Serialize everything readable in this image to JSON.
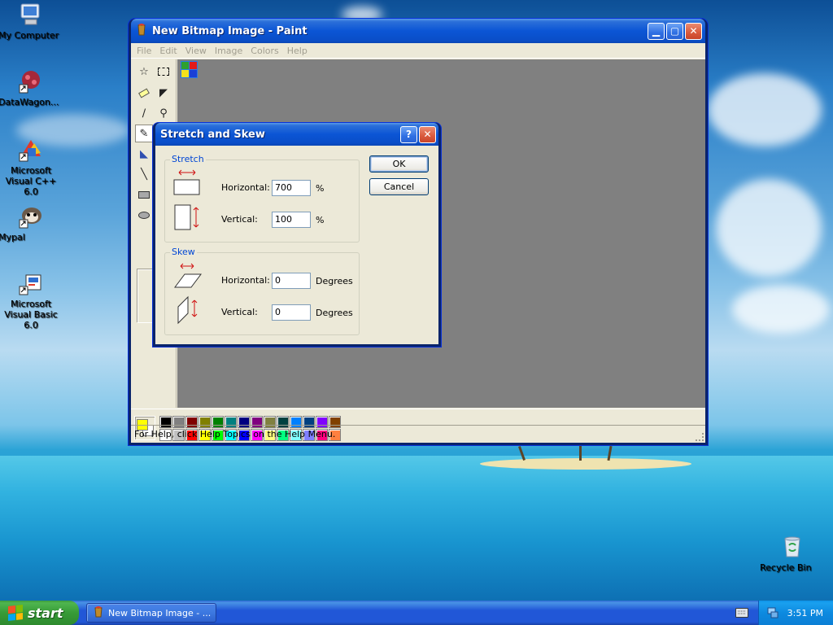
{
  "desktop": {
    "icons": [
      {
        "label": "My Computer"
      },
      {
        "label": "DataWagon..."
      },
      {
        "label": "Microsoft Visual C++ 6.0"
      },
      {
        "label": "Mypal"
      },
      {
        "label": "Microsoft Visual Basic 6.0"
      },
      {
        "label": "Recycle Bin"
      }
    ]
  },
  "paint": {
    "title": "New Bitmap Image - Paint",
    "menu": [
      "File",
      "Edit",
      "View",
      "Image",
      "Colors",
      "Help"
    ],
    "status_text": "For Help, click Help Topics on the Help Menu.",
    "palette_top": [
      "#000000",
      "#808080",
      "#800000",
      "#808000",
      "#008000",
      "#008080",
      "#000080",
      "#800080",
      "#808040",
      "#004040",
      "#0080ff",
      "#004080",
      "#8000ff",
      "#804000"
    ],
    "palette_bottom": [
      "#ffffff",
      "#c0c0c0",
      "#ff0000",
      "#ffff00",
      "#00ff00",
      "#00ffff",
      "#0000ff",
      "#ff00ff",
      "#ffff80",
      "#00ff80",
      "#80ffff",
      "#8080ff",
      "#ff0080",
      "#ff8040"
    ],
    "foreground_color": "#ffff00",
    "background_color": "#ffffff"
  },
  "dialog": {
    "title": "Stretch and Skew",
    "stretch_label": "Stretch",
    "skew_label": "Skew",
    "horizontal_label": "Horizontal:",
    "vertical_label": "Vertical:",
    "stretch_horizontal": "700",
    "stretch_vertical": "100",
    "skew_horizontal": "0",
    "skew_vertical": "0",
    "percent": "%",
    "degrees": "Degrees",
    "ok": "OK",
    "cancel": "Cancel"
  },
  "taskbar": {
    "start": "start",
    "task": "New Bitmap Image - ...",
    "clock": "3:51 PM"
  }
}
